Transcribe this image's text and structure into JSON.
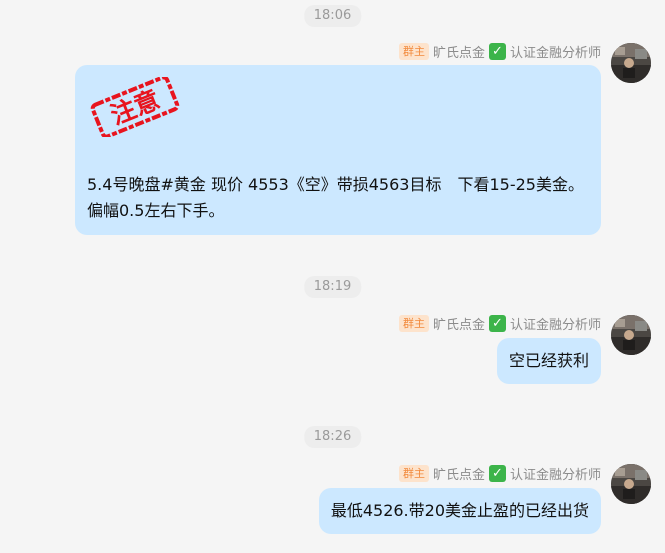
{
  "messages": [
    {
      "time": "18:06",
      "sender_badge": "群主",
      "sender_name": "旷氏点金",
      "sender_verified": "认证金融分析师",
      "stamp_text": "注意",
      "text": "5.4号晚盘#黄金 现价 4553《空》带损4563目标　下看15-25美金。偏幅0.5左右下手。"
    },
    {
      "time": "18:19",
      "sender_badge": "群主",
      "sender_name": "旷氏点金",
      "sender_verified": "认证金融分析师",
      "text": "空已经获利"
    },
    {
      "time": "18:26",
      "sender_badge": "群主",
      "sender_name": "旷氏点金",
      "sender_verified": "认证金融分析师",
      "text": "最低4526.带20美金止盈的已经出货"
    }
  ],
  "colors": {
    "bubble": "#cce8ff",
    "badge_bg": "#fde3cc",
    "badge_text": "#f28a3c",
    "verified": "#3cb44a",
    "stamp": "#e8141e",
    "background": "#f5f5f5"
  },
  "icons": [
    "avatar",
    "verified-check-icon",
    "attention-stamp"
  ]
}
